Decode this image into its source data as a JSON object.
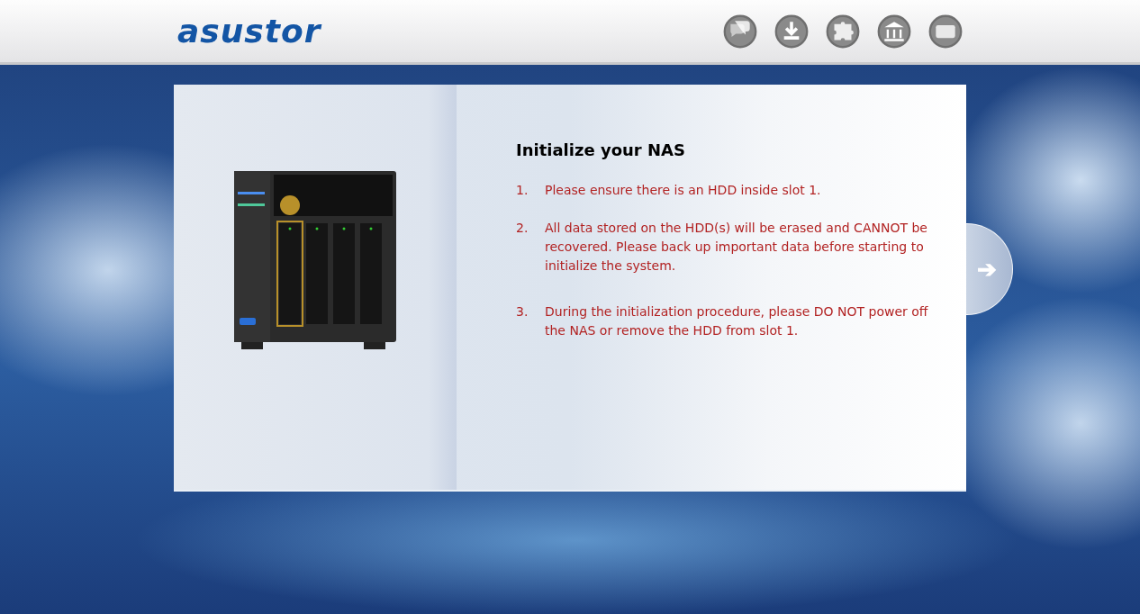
{
  "header": {
    "logo": "asustor",
    "icons": [
      {
        "kind": "chat"
      },
      {
        "kind": "download"
      },
      {
        "kind": "puzzle"
      },
      {
        "kind": "bank"
      },
      {
        "kind": "card"
      }
    ]
  },
  "panel": {
    "title": "Initialize your NAS",
    "steps": [
      {
        "number": "1.",
        "text": "Please ensure there is an HDD inside slot 1."
      },
      {
        "number": "2.",
        "text": "All data stored on the HDD(s) will be erased and CANNOT be recovered. Please back up important data before starting to initialize the system."
      },
      {
        "number": "3.",
        "text": "During the initialization procedure, please DO NOT power off the NAS or remove the HDD from slot 1."
      }
    ],
    "next_button": "➔"
  }
}
